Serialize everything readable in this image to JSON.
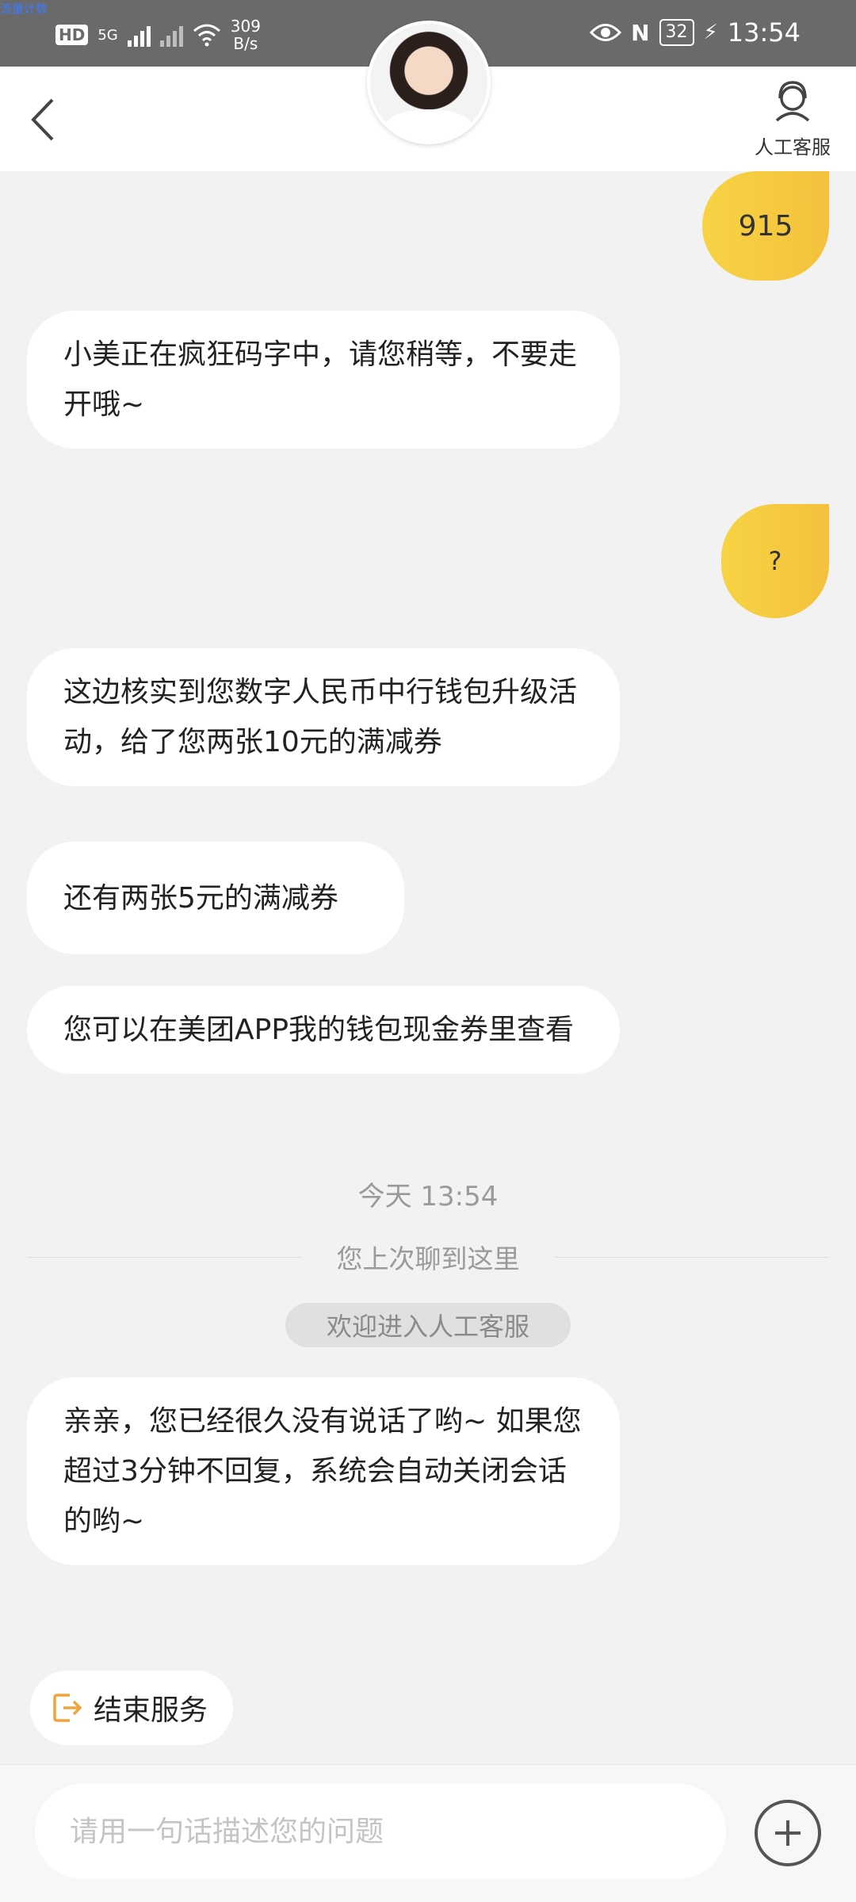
{
  "status_bar": {
    "tag": "流量计数",
    "hd": "HD",
    "net_type": "5G",
    "speed_value": "309",
    "speed_unit": "B/s",
    "nfc": "N",
    "battery": "32",
    "time": "13:54"
  },
  "header": {
    "agent_label": "人工客服"
  },
  "messages": [
    {
      "from": "user",
      "text": "915"
    },
    {
      "from": "bot",
      "text": "小美正在疯狂码字中，请您稍等，不要走开哦~"
    },
    {
      "from": "user",
      "text": "?"
    },
    {
      "from": "bot",
      "text": "这边核实到您数字人民币中行钱包升级活动，给了您两张10元的满减券"
    },
    {
      "from": "bot",
      "text": "还有两张5元的满减券"
    },
    {
      "from": "bot",
      "text": "您可以在美团APP我的钱包现金券里查看"
    }
  ],
  "timestamp": "今天 13:54",
  "divider_text": "您上次聊到这里",
  "welcome_text": "欢迎进入人工客服",
  "last_message": {
    "from": "bot",
    "text": "亲亲，您已经很久没有说话了哟~ 如果您超过3分钟不回复，系统会自动关闭会话的哟~"
  },
  "end_service_label": "结束服务",
  "input": {
    "placeholder": "请用一句话描述您的问题",
    "value": ""
  },
  "colors": {
    "user_bubble": "#f6ca3e",
    "end_icon": "#f0a43a"
  }
}
